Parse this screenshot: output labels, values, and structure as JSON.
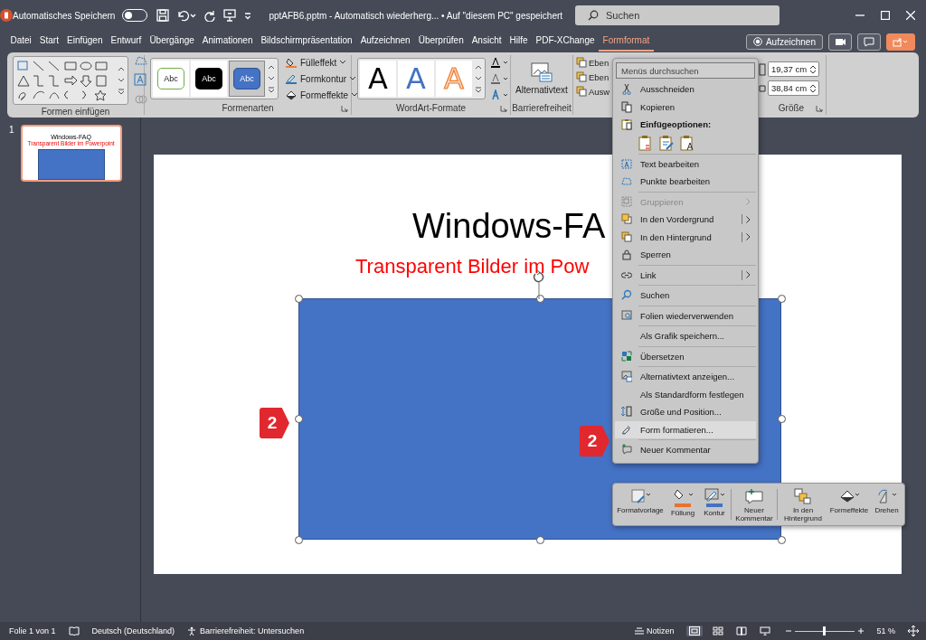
{
  "titlebar": {
    "autosave_label": "Automatisches Speichern",
    "autosave_on": false,
    "document_title": "pptAFB6.pptm  -  Automatisch wiederherg...  •  Auf \"diesem PC\" gespeichert",
    "search_placeholder": "Suchen"
  },
  "ribbon_tabs": [
    {
      "label": "Datei",
      "selected": false
    },
    {
      "label": "Start",
      "selected": false
    },
    {
      "label": "Einfügen",
      "selected": false
    },
    {
      "label": "Entwurf",
      "selected": false
    },
    {
      "label": "Übergänge",
      "selected": false
    },
    {
      "label": "Animationen",
      "selected": false
    },
    {
      "label": "Bildschirmpräsentation",
      "selected": false
    },
    {
      "label": "Aufzeichnen",
      "selected": false
    },
    {
      "label": "Überprüfen",
      "selected": false
    },
    {
      "label": "Ansicht",
      "selected": false
    },
    {
      "label": "Hilfe",
      "selected": false
    },
    {
      "label": "PDF-XChange",
      "selected": false
    },
    {
      "label": "Formformat",
      "selected": true
    }
  ],
  "record_button": "Aufzeichnen",
  "ribbon": {
    "shapes": {
      "label": "Formen einfügen"
    },
    "styles": {
      "label": "Formenarten",
      "tiles": [
        {
          "text": "Abc",
          "kind": "outline",
          "selected": false
        },
        {
          "text": "Abc",
          "kind": "dark",
          "selected": false
        },
        {
          "text": "Abc",
          "kind": "filled",
          "selected": true
        }
      ],
      "commands": [
        "Fülleffekt",
        "Formkontur",
        "Formeffekte"
      ]
    },
    "wordart": {
      "label": "WordArt-Formate",
      "tiles": [
        {
          "text": "A",
          "kind": "plain"
        },
        {
          "text": "A",
          "kind": "blue"
        },
        {
          "text": "A",
          "kind": "orange"
        }
      ]
    },
    "accessibility": {
      "label": "Barrierefreiheit",
      "button": "Alternativtext"
    },
    "arrange": {
      "items": [
        "Eben",
        "Eben",
        "Ausw"
      ]
    },
    "size": {
      "label": "Größe",
      "height": "19,37 cm",
      "width": "38,84 cm"
    }
  },
  "thumbnails": [
    {
      "number": "1",
      "selected": true,
      "title": "Windows-FAQ",
      "subtitle": "Transparent Bilder im Powerpoint"
    }
  ],
  "slide": {
    "title": "Windows-FA",
    "subtitle": "Transparent Bilder im Pow"
  },
  "context_menu": [
    {
      "kind": "search",
      "placeholder": "Menüs durchsuchen"
    },
    {
      "kind": "item",
      "label": "Ausschneiden",
      "disabled": false,
      "submenu": false,
      "selected": false
    },
    {
      "kind": "item",
      "label": "Kopieren",
      "disabled": false,
      "submenu": false,
      "selected": false
    },
    {
      "kind": "header",
      "label": "Einfügeoptionen:"
    },
    {
      "kind": "paste-options"
    },
    {
      "kind": "separator"
    },
    {
      "kind": "item",
      "label": "Text bearbeiten",
      "disabled": false,
      "submenu": false,
      "selected": false
    },
    {
      "kind": "item",
      "label": "Punkte bearbeiten",
      "disabled": false,
      "submenu": false,
      "selected": false
    },
    {
      "kind": "separator"
    },
    {
      "kind": "item",
      "label": "Gruppieren",
      "disabled": true,
      "submenu": true,
      "selected": false
    },
    {
      "kind": "item",
      "label": "In den Vordergrund",
      "disabled": false,
      "submenu": true,
      "selected": false
    },
    {
      "kind": "item",
      "label": "In den Hintergrund",
      "disabled": false,
      "submenu": true,
      "selected": false
    },
    {
      "kind": "item",
      "label": "Sperren",
      "disabled": false,
      "submenu": false,
      "selected": false
    },
    {
      "kind": "separator"
    },
    {
      "kind": "item",
      "label": "Link",
      "disabled": false,
      "submenu": true,
      "selected": false
    },
    {
      "kind": "separator"
    },
    {
      "kind": "item",
      "label": "Suchen",
      "disabled": false,
      "submenu": false,
      "selected": false
    },
    {
      "kind": "separator"
    },
    {
      "kind": "item",
      "label": "Folien wiederverwenden",
      "disabled": false,
      "submenu": false,
      "selected": false
    },
    {
      "kind": "separator"
    },
    {
      "kind": "item",
      "label": "Als Grafik speichern...",
      "disabled": false,
      "submenu": false,
      "selected": false
    },
    {
      "kind": "separator"
    },
    {
      "kind": "item",
      "label": "Übersetzen",
      "disabled": false,
      "submenu": false,
      "selected": false
    },
    {
      "kind": "separator"
    },
    {
      "kind": "item",
      "label": "Alternativtext anzeigen...",
      "disabled": false,
      "submenu": false,
      "selected": false
    },
    {
      "kind": "item",
      "label": "Als Standardform festlegen",
      "disabled": false,
      "submenu": false,
      "selected": false
    },
    {
      "kind": "item",
      "label": "Größe und Position...",
      "disabled": false,
      "submenu": false,
      "selected": false
    },
    {
      "kind": "item",
      "label": "Form formatieren...",
      "disabled": false,
      "submenu": false,
      "selected": true
    },
    {
      "kind": "separator"
    },
    {
      "kind": "item",
      "label": "Neuer Kommentar",
      "disabled": false,
      "submenu": false,
      "selected": false
    }
  ],
  "mini_toolbar": [
    {
      "label": "Formatvorlage"
    },
    {
      "label": "Füllung",
      "color": "#e97132"
    },
    {
      "label": "Kontur",
      "color": "#4472c4"
    },
    {
      "label": "Neuer Kommentar"
    },
    {
      "label": "In den Hintergrund"
    },
    {
      "label": "Formeffekte"
    },
    {
      "label": "Drehen"
    }
  ],
  "callouts": [
    {
      "text": "2"
    },
    {
      "text": "2"
    }
  ],
  "status_bar": {
    "slide_info": "Folie 1 von 1",
    "language": "Deutsch (Deutschland)",
    "accessibility": "Barrierefreiheit: Untersuchen",
    "notes": "Notizen",
    "zoom_slider": {
      "level": 0.47
    },
    "zoom": "51 %"
  }
}
